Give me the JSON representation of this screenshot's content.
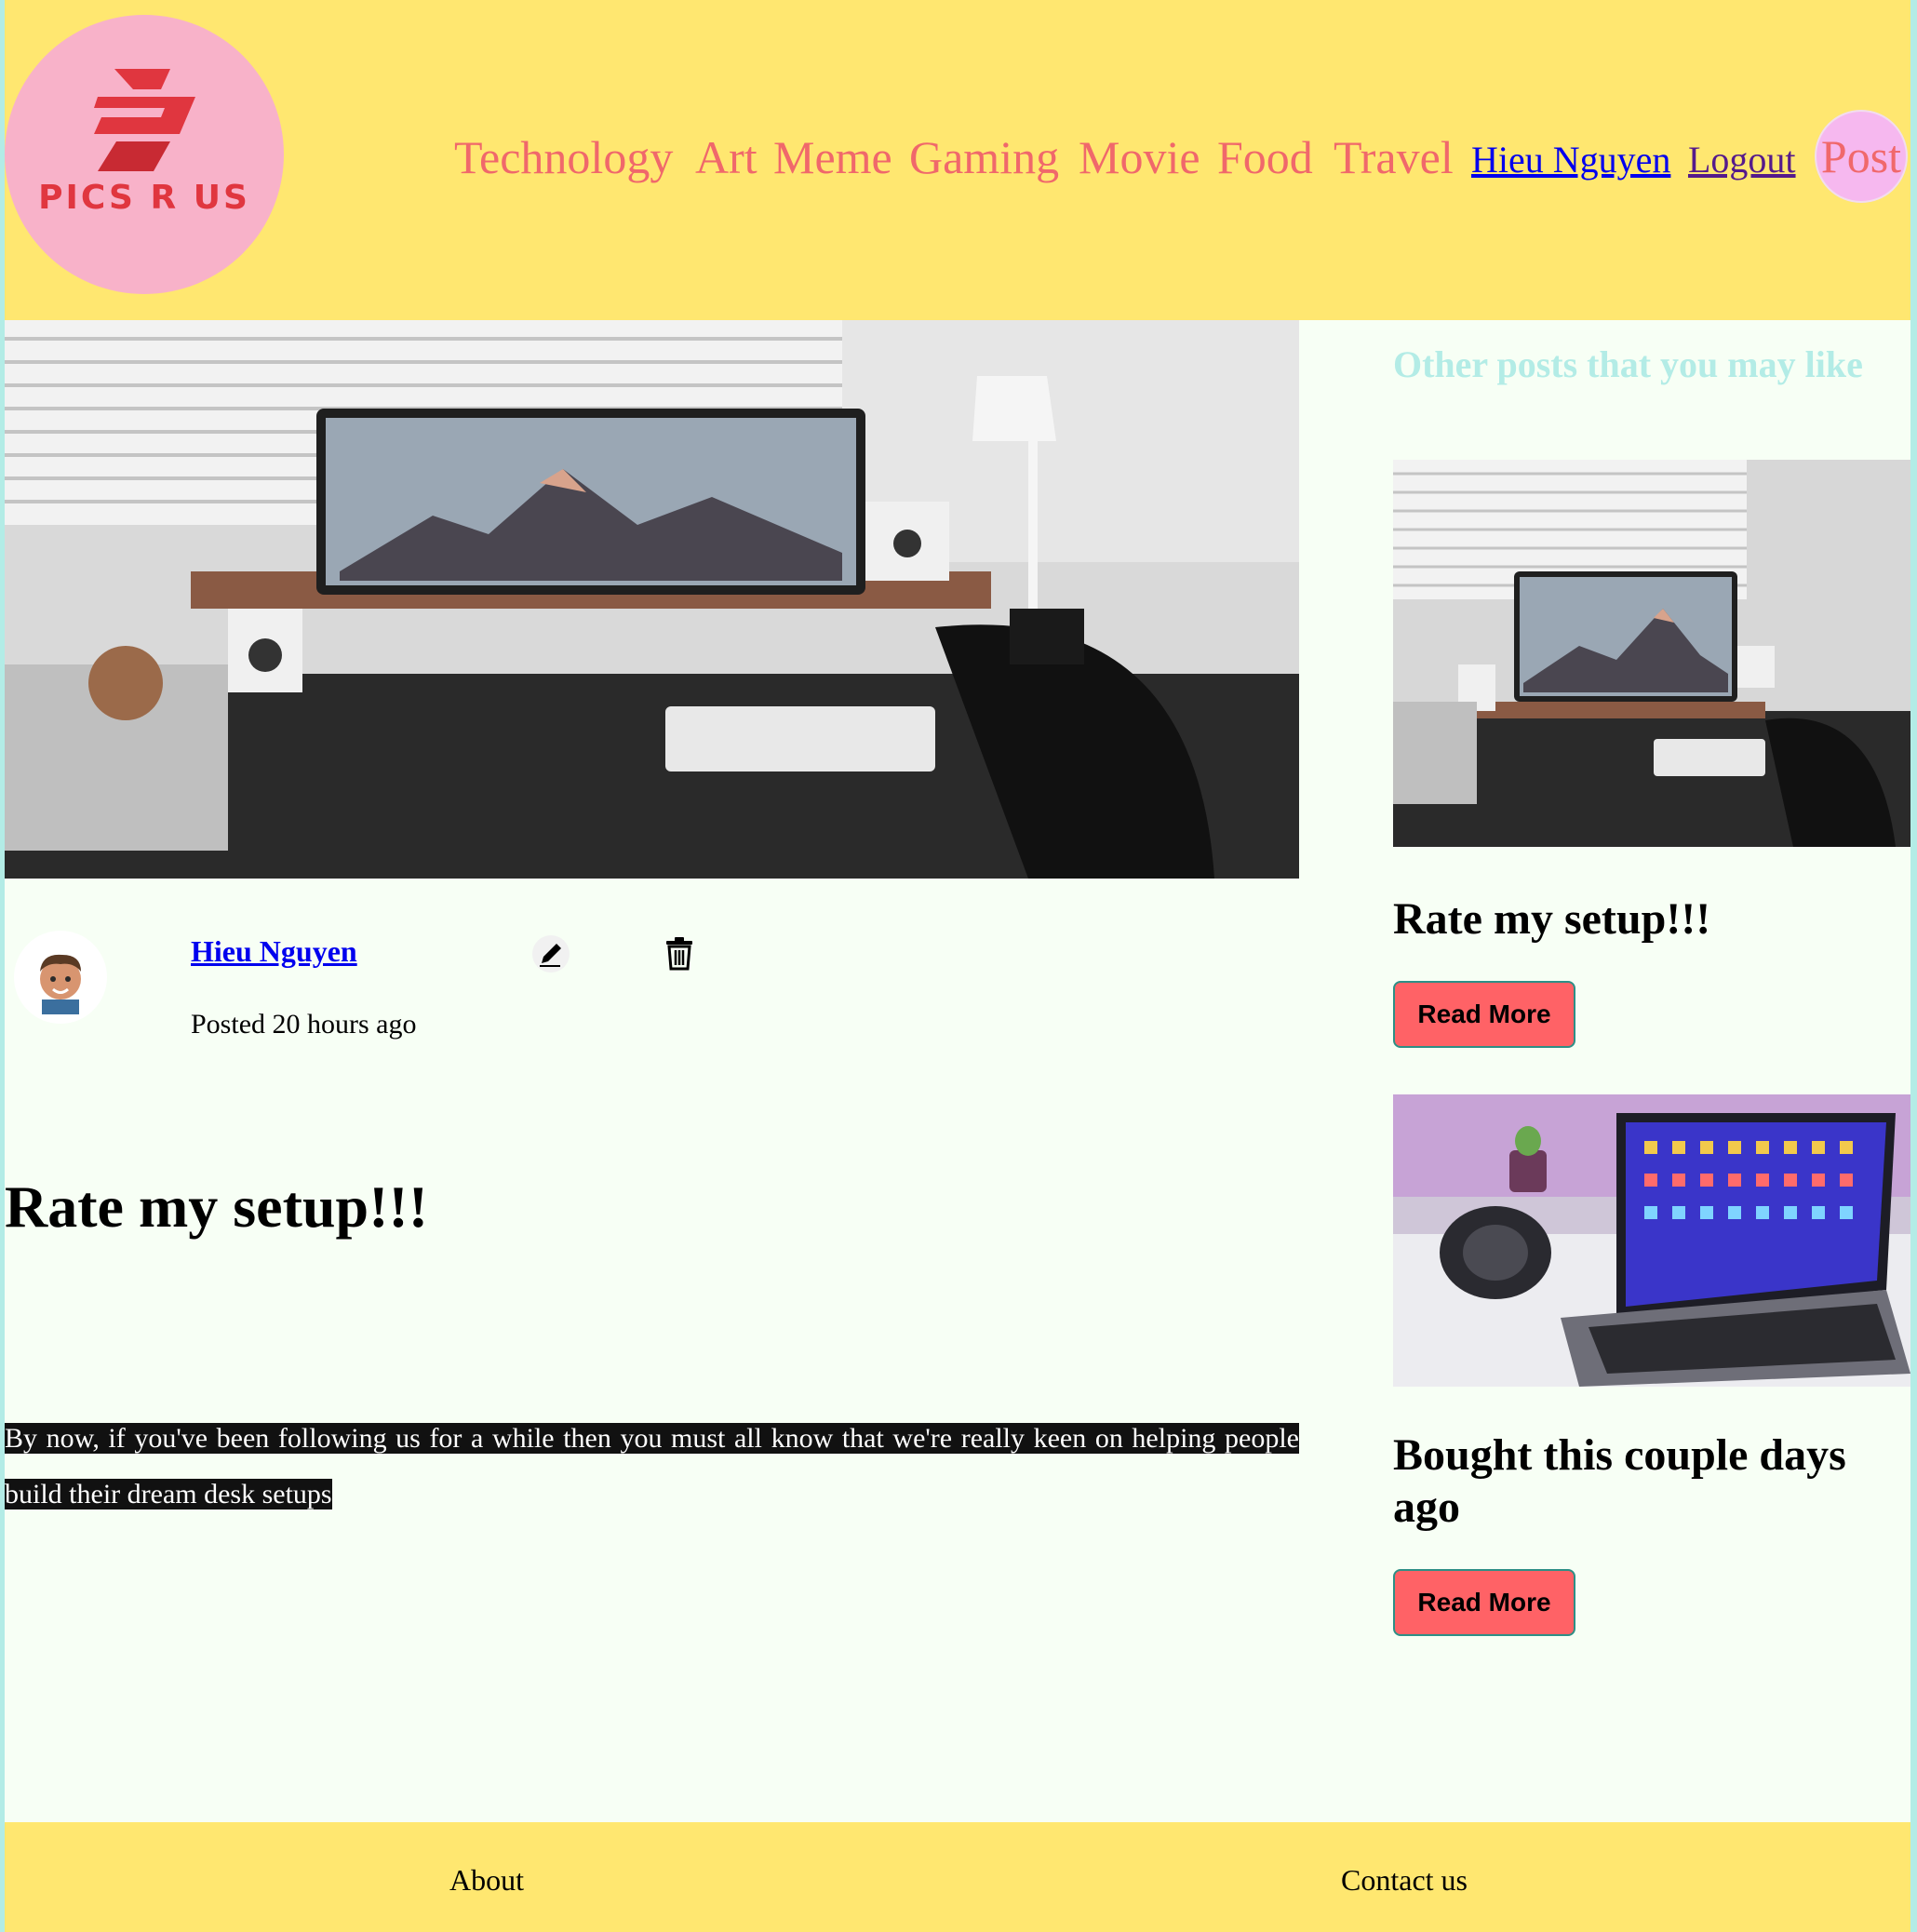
{
  "header": {
    "logo_text": "PICS R US",
    "categories": [
      "Technology",
      "Art",
      "Meme",
      "Gaming",
      "Movie",
      "Food",
      "Travel"
    ],
    "user_link": "Hieu Nguyen",
    "logout_link": "Logout",
    "post_button": "Post"
  },
  "post": {
    "image_icon": "desk-setup-photo",
    "author": "Hieu Nguyen",
    "posted": "Posted 20 hours ago",
    "title": "Rate my setup!!!",
    "body": "By now, if you've been following us for a while then you must all know that we're really keen on helping people build their dream desk setups",
    "edit_icon": "pencil-icon",
    "delete_icon": "trash-icon"
  },
  "sidebar": {
    "heading": "Other posts that you may like",
    "posts": [
      {
        "title": "Rate my setup!!!",
        "button": "Read More",
        "image_icon": "desk-setup-photo"
      },
      {
        "title": "Bought this couple days ago",
        "button": "Read More",
        "image_icon": "laptop-photo"
      }
    ]
  },
  "footer": {
    "about": "About",
    "contact": "Contact us"
  },
  "colors": {
    "header_bg": "#ffe770",
    "nav_text": "#f0686b",
    "page_bg": "#f7fff5",
    "accent_teal": "#b3ece6",
    "button_bg": "#ff6266",
    "post_button_bg": "#f6b8ef"
  }
}
